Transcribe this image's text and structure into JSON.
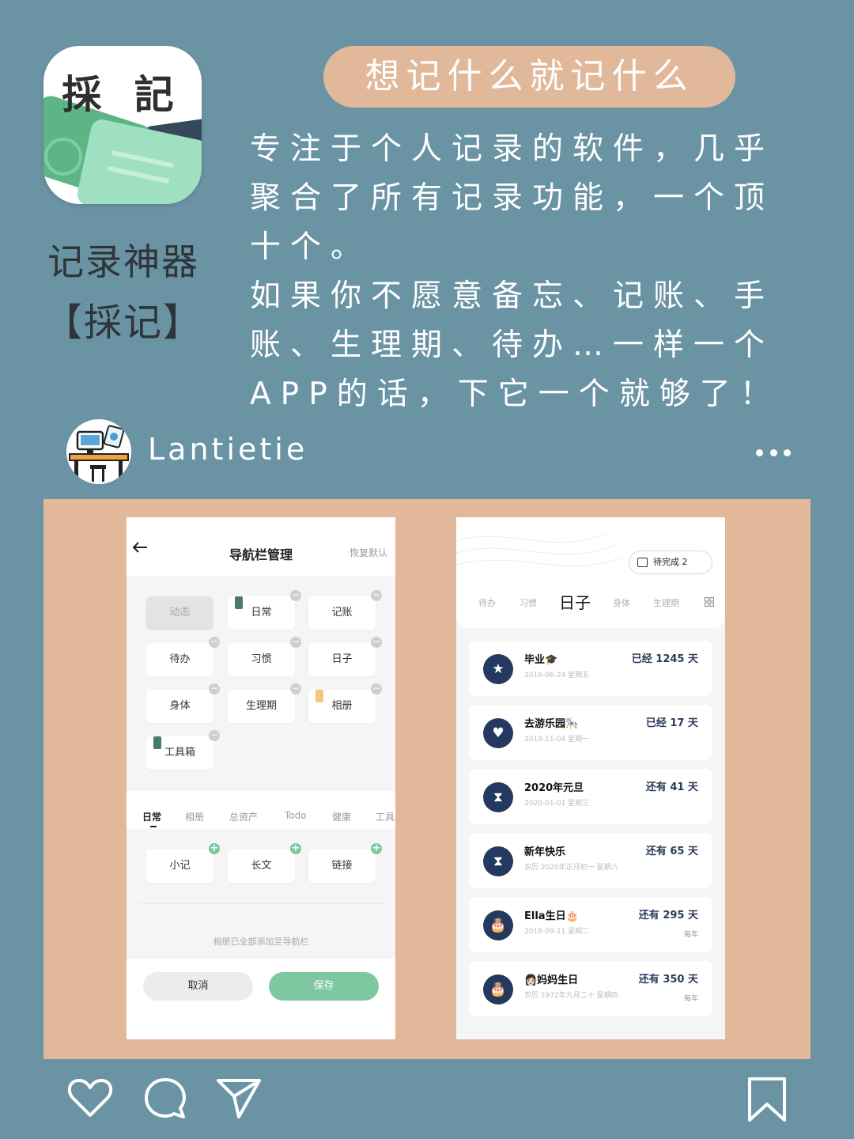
{
  "header": {
    "app_icon_title": "採 記",
    "caption_line1": "记录神器",
    "caption_line2": "【採记】",
    "headline": "想记什么就记什么",
    "description": [
      "专注于个人记录的软件，几乎",
      "聚合了所有记录功能，一个顶",
      "十个。",
      "如果你不愿意备忘、记账、手",
      "账、生理期、待办…一样一个",
      "APP的话，下它一个就够了！"
    ]
  },
  "profile": {
    "username": "Lantietie"
  },
  "left_phone": {
    "title": "导航栏管理",
    "restore": "恢复默认",
    "nav_items": [
      "动态",
      "日常",
      "记账",
      "待办",
      "习惯",
      "日子",
      "身体",
      "生理期",
      "相册",
      "工具箱"
    ],
    "tabs": [
      "日常",
      "相册",
      "总资产",
      "Todo",
      "健康",
      "工具"
    ],
    "add_items": [
      "小记",
      "长文",
      "链接"
    ],
    "note": "相册已全部添加至导航栏",
    "cancel": "取消",
    "save": "保存",
    "minus_sign": "−",
    "plus_sign": "+"
  },
  "right_phone": {
    "pending": "待完成 2",
    "tabs": [
      "待办",
      "习惯",
      "日子",
      "身体",
      "生理期"
    ],
    "events": [
      {
        "name": "毕业🎓",
        "date": "2016-06-24 星期五",
        "count": "已经 1245 天",
        "repeat": "",
        "icon": "★"
      },
      {
        "name": "去游乐园🎠",
        "date": "2019-11-04 星期一",
        "count": "已经 17 天",
        "repeat": "",
        "icon": "♥"
      },
      {
        "name": "2020年元旦",
        "date": "2020-01-01 星期三",
        "count": "还有 41 天",
        "repeat": "",
        "icon": "⧗"
      },
      {
        "name": "新年快乐",
        "date": "农历 2020年正月初一 星期六",
        "count": "还有 65 天",
        "repeat": "",
        "icon": "⧗"
      },
      {
        "name": "Ella生日🎂",
        "date": "2018-09-11 星期二",
        "count": "还有 295 天",
        "repeat": "每年",
        "icon": "🎂"
      },
      {
        "name": "👩🏻妈妈生日",
        "date": "农历 1972年九月二十 星期四",
        "count": "还有 350 天",
        "repeat": "每年",
        "icon": "🎂"
      }
    ]
  },
  "colors": {
    "background": "#6a93a4",
    "accent_peach": "#e2b89a",
    "green": "#7fc7a0",
    "navy": "#23395f"
  },
  "icons": {
    "like": "heart-icon",
    "comment": "speech-bubble-icon",
    "share": "paper-plane-icon",
    "bookmark": "bookmark-icon"
  }
}
